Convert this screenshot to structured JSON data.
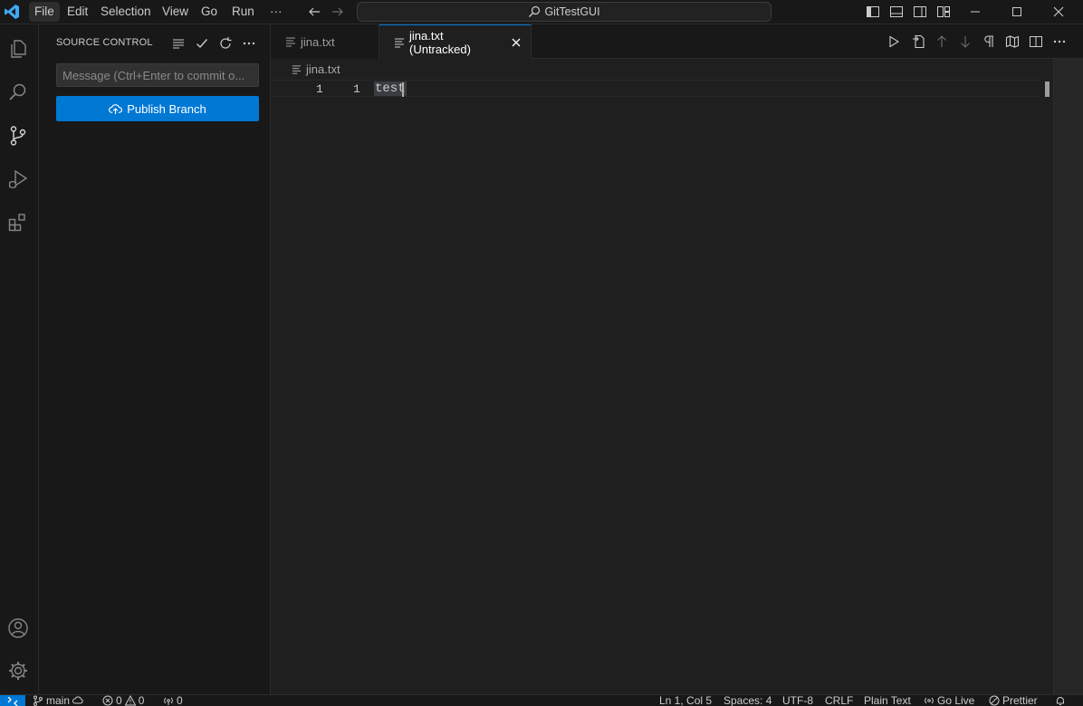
{
  "titlebar": {
    "menus": [
      "File",
      "Edit",
      "Selection",
      "View",
      "Go",
      "Run"
    ],
    "more": "···",
    "search_text": "GitTestGUI"
  },
  "sidebar": {
    "title": "SOURCE CONTROL",
    "commit_placeholder": "Message (Ctrl+Enter to commit o...",
    "publish_label": "Publish Branch"
  },
  "tabs": [
    {
      "label": "jina.txt",
      "active": false
    },
    {
      "label": "jina.txt (Untracked)",
      "active": true
    }
  ],
  "editor": {
    "breadcrumb": "jina.txt",
    "original_line": "1",
    "modified_line": "1",
    "code": "test"
  },
  "statusbar": {
    "branch": "main",
    "errors": "0",
    "warnings": "0",
    "ports": "0",
    "position": "Ln 1, Col 5",
    "spaces": "Spaces: 4",
    "encoding": "UTF-8",
    "eol": "CRLF",
    "language": "Plain Text",
    "golive": "Go Live",
    "prettier": "Prettier"
  },
  "colors": {
    "accent": "#0078d4",
    "background": "#1f1f1f",
    "chrome": "#181818"
  }
}
